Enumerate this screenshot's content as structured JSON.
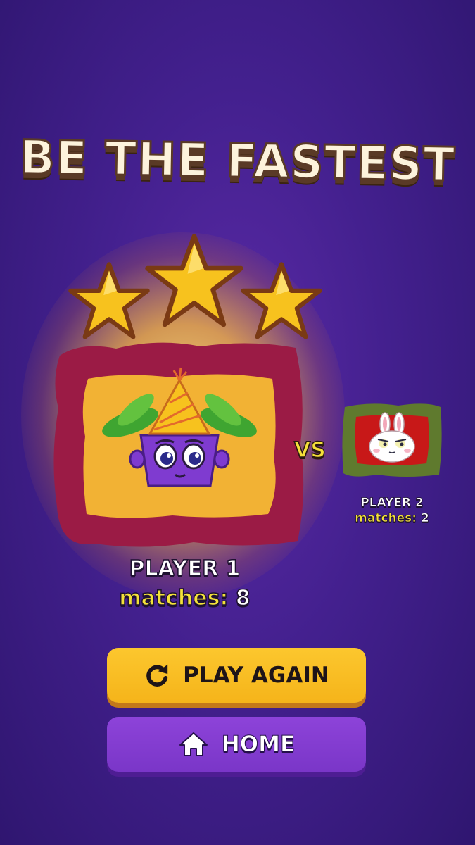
{
  "title": "BE THE FASTEST",
  "stars": {
    "earned": 3,
    "total": 3
  },
  "versus_label": "VS",
  "player1": {
    "name": "PLAYER 1",
    "matches_label": "matches:",
    "matches_value": "8"
  },
  "player2": {
    "name": "PLAYER 2",
    "matches_label": "matches:",
    "matches_value": "2"
  },
  "buttons": {
    "play_again": {
      "label": "PLAY AGAIN",
      "icon": "restart-icon"
    },
    "home": {
      "label": "HOME",
      "icon": "home-icon"
    }
  },
  "colors": {
    "background": "#43208e",
    "star": "#f7c21e",
    "player1_frame": "#9b1b45",
    "player1_fill": "#f2b234",
    "player2_frame": "#5f7a2e",
    "player2_fill": "#c81818",
    "play_button": "#f7bb22",
    "home_button": "#8540d2"
  }
}
